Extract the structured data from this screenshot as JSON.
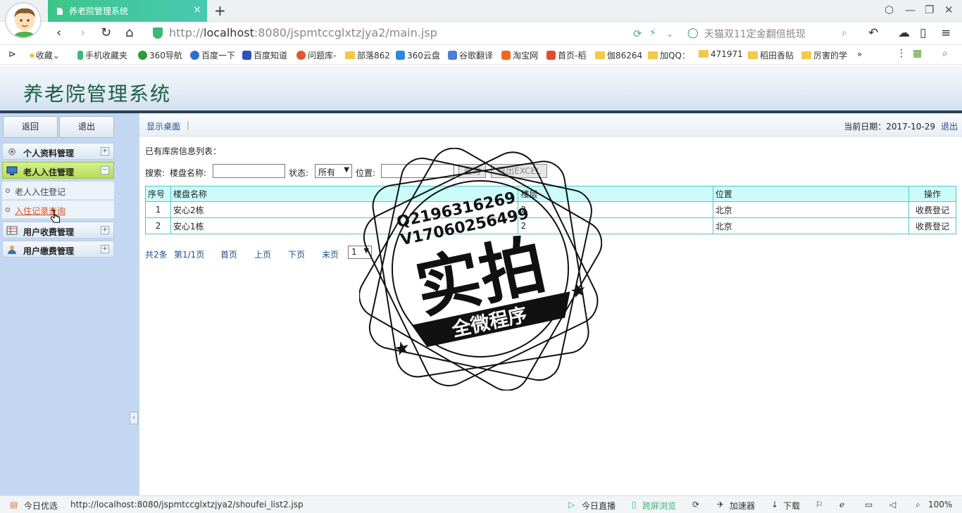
{
  "browser": {
    "tab_title": "养老院管理系统",
    "tab_close": "×",
    "new_tab": "+",
    "url_prefix": "http://",
    "url_host": "localhost",
    "url_rest": ":8080/jspmtccglxtzjya2/main.jsp",
    "search_placeholder": "天猫双11定金翻倍抵现",
    "bookmarks": [
      {
        "label": "收藏"
      },
      {
        "label": "手机收藏夹"
      },
      {
        "label": "360导航"
      },
      {
        "label": "百度一下"
      },
      {
        "label": "百度知道"
      },
      {
        "label": "问题库-"
      },
      {
        "label": "部落862"
      },
      {
        "label": "360云盘"
      },
      {
        "label": "谷歌翻译"
      },
      {
        "label": "淘宝网"
      },
      {
        "label": "首页-稻"
      },
      {
        "label": "伽86264"
      },
      {
        "label": "加QQ："
      },
      {
        "label": "471971"
      },
      {
        "label": "稻田香贴"
      },
      {
        "label": "厉害的学"
      }
    ],
    "more": "»"
  },
  "app": {
    "title": "养老院管理系统"
  },
  "sidebar": {
    "back_label": "返回",
    "exit_label": "退出",
    "menus": [
      {
        "label": "个人资料管理",
        "toggle": "+",
        "icon": "gear-icon"
      },
      {
        "label": "老人入住管理",
        "toggle": "−",
        "icon": "monitor-icon"
      },
      {
        "label": "用户收费管理",
        "toggle": "+",
        "icon": "table-icon"
      },
      {
        "label": "用户缴费管理",
        "toggle": "+",
        "icon": "user-icon"
      }
    ],
    "submenus": [
      {
        "label": "老人入住登记"
      },
      {
        "label": "入住记录查询"
      }
    ],
    "collapse": "‹"
  },
  "topbar": {
    "show_desktop": "显示桌面",
    "separator": "|",
    "date_label": "当前日期：2017-10-29",
    "logout": "退出"
  },
  "main": {
    "list_title": "已有库房信息列表：",
    "search_label": "搜索:",
    "building_label": "楼盘名称:",
    "status_label": "状态:",
    "status_value": "所有",
    "location_label": "位置:",
    "query_button": "查询",
    "export_button": "导出EXCEL"
  },
  "table": {
    "headers": [
      "序号",
      "楼盘名称",
      "楼层",
      "位置",
      "操作"
    ],
    "rows": [
      {
        "no": "1",
        "name": "安心2栋",
        "floor": "2",
        "location": "北京",
        "action": "收费登记"
      },
      {
        "no": "2",
        "name": "安心1栋",
        "floor": "2",
        "location": "北京",
        "action": "收费登记"
      }
    ]
  },
  "pager": {
    "total": "共2条",
    "page": "第1/1页",
    "first": "首页",
    "prev": "上页",
    "next": "下页",
    "last": "末页",
    "select_value": "1"
  },
  "statusbar": {
    "promo": "今日优选",
    "link_url": "http://localhost:8080/jspmtccglxtzjya2/shoufei_list2.jsp",
    "live": "今日直播",
    "cross_screen": "跨屏浏览",
    "accelerator": "加速器",
    "download": "下载",
    "zoom": "100%"
  },
  "watermark": {
    "line1": "Q2196316269",
    "line2": "V17060256499",
    "big": "实拍",
    "banner": "全微程序"
  },
  "colors": {
    "accent_green": "#3cc58a",
    "header_dark": "#28405a",
    "sidebar_bg": "#c3d8f0",
    "table_header_bg": "#ccfbfb",
    "table_border": "#52c6c8",
    "link_blue": "#1f4d8c",
    "active_menu": "#b5dc56"
  }
}
